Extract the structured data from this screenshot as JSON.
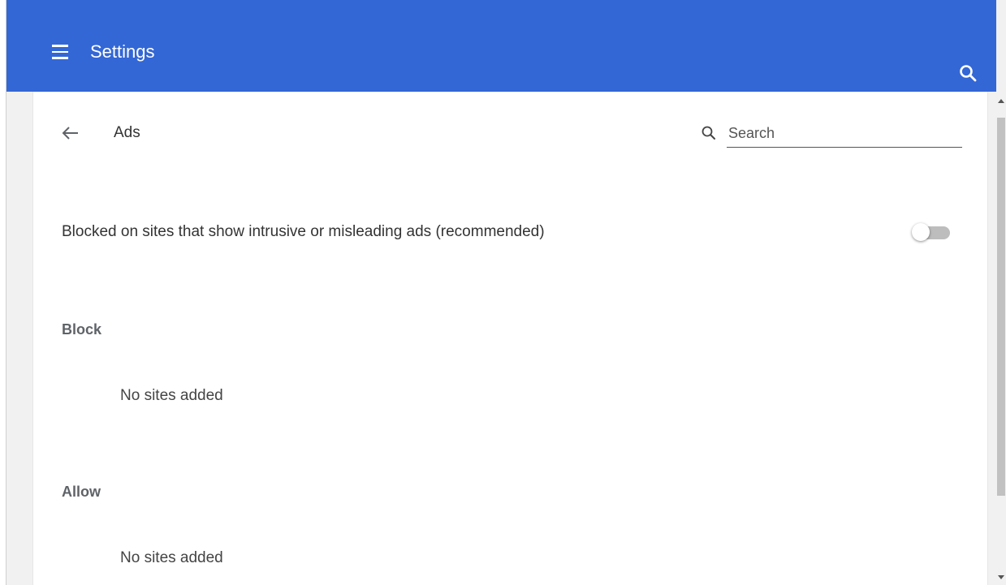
{
  "header": {
    "title": "Settings",
    "menu_icon": "hamburger-menu-icon",
    "search_icon": "search-icon",
    "background_color": "#3367d6"
  },
  "page": {
    "back_icon": "arrow-back-icon",
    "title": "Ads",
    "search": {
      "icon": "search-icon",
      "placeholder": "Search",
      "value": ""
    }
  },
  "setting": {
    "label": "Blocked on sites that show intrusive or misleading ads (recommended)",
    "enabled": false
  },
  "sections": [
    {
      "heading": "Block",
      "empty_text": "No sites added"
    },
    {
      "heading": "Allow",
      "empty_text": "No sites added"
    }
  ]
}
